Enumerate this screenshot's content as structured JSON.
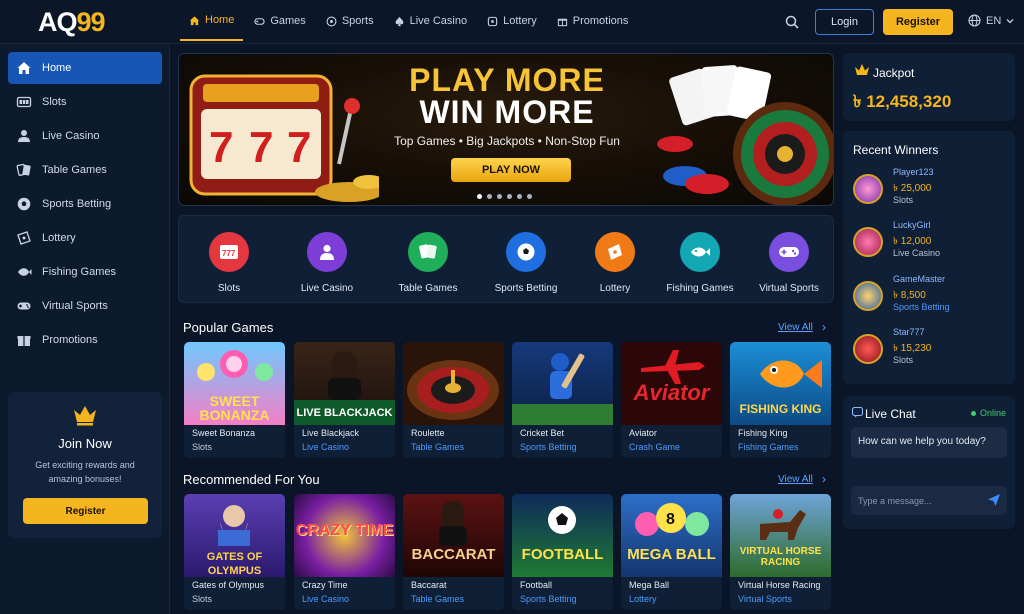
{
  "brand": {
    "prefix": "AQ",
    "suffix": "99"
  },
  "nav": [
    {
      "label": "Home",
      "icon": "home-icon",
      "active": true
    },
    {
      "label": "Games",
      "icon": "gamepad-icon"
    },
    {
      "label": "Sports",
      "icon": "soccer-ball-icon"
    },
    {
      "label": "Live Casino",
      "icon": "spade-icon"
    },
    {
      "label": "Lottery",
      "icon": "lottery-ball-icon"
    },
    {
      "label": "Promotions",
      "icon": "gift-icon"
    }
  ],
  "header": {
    "login": "Login",
    "register": "Register",
    "lang": "EN"
  },
  "sidebar": {
    "items": [
      {
        "label": "Home",
        "icon": "home-icon",
        "active": true
      },
      {
        "label": "Slots",
        "icon": "slot-machine-icon"
      },
      {
        "label": "Live Casino",
        "icon": "dealer-icon"
      },
      {
        "label": "Table Games",
        "icon": "cards-icon"
      },
      {
        "label": "Sports Betting",
        "icon": "soccer-ball-icon"
      },
      {
        "label": "Lottery",
        "icon": "ticket-icon"
      },
      {
        "label": "Fishing Games",
        "icon": "fish-icon"
      },
      {
        "label": "Virtual Sports",
        "icon": "controller-icon"
      },
      {
        "label": "Promotions",
        "icon": "gift-icon"
      }
    ],
    "promo": {
      "title": "Join Now",
      "desc": "Get exciting rewards and amazing bonuses!",
      "button": "Register"
    }
  },
  "banner": {
    "title1": "PLAY MORE",
    "title2": "WIN MORE",
    "subtitle": "Top Games  •  Big Jackpots  •  Non-Stop Fun",
    "button": "PLAY NOW",
    "slides": 6,
    "active_slide": 0
  },
  "categories": [
    {
      "label": "Slots",
      "color": "#e5373f"
    },
    {
      "label": "Live Casino",
      "color": "#7c3ed6"
    },
    {
      "label": "Table Games",
      "color": "#1fae5a"
    },
    {
      "label": "Sports Betting",
      "color": "#1f6fe0"
    },
    {
      "label": "Lottery",
      "color": "#f07a16"
    },
    {
      "label": "Fishing Games",
      "color": "#12a7b3"
    },
    {
      "label": "Virtual Sports",
      "color": "#7a4fe0"
    }
  ],
  "popular": {
    "title": "Popular Games",
    "view_all": "View All",
    "games": [
      {
        "art": "SWEET BONANZA",
        "name": "Sweet Bonanza",
        "category": "Slots",
        "blue": false
      },
      {
        "art": "LIVE BLACKJACK",
        "name": "Live Blackjack",
        "category": "Live Casino",
        "blue": true
      },
      {
        "art": "",
        "name": "Roulette",
        "category": "Table Games",
        "blue": true
      },
      {
        "art": "",
        "name": "Cricket Bet",
        "category": "Sports Betting",
        "blue": true
      },
      {
        "art": "Aviator",
        "name": "Aviator",
        "category": "Crash Game",
        "blue": true
      },
      {
        "art": "FISHING KING",
        "name": "Fishing King",
        "category": "Fishing Games",
        "blue": true
      }
    ]
  },
  "recommended": {
    "title": "Recommended For You",
    "view_all": "View All",
    "games": [
      {
        "art": "GATES OF OLYMPUS",
        "name": "Gates of Olympus",
        "category": "Slots",
        "blue": false
      },
      {
        "art": "CRAZY TIME",
        "name": "Crazy Time",
        "category": "Live Casino",
        "blue": true
      },
      {
        "art": "BACCARAT",
        "name": "Baccarat",
        "category": "Table Games",
        "blue": true
      },
      {
        "art": "FOOTBALL",
        "name": "Football",
        "category": "Sports Betting",
        "blue": true
      },
      {
        "art": "MEGA BALL",
        "name": "Mega Ball",
        "category": "Lottery",
        "blue": true
      },
      {
        "art": "VIRTUAL HORSE RACING",
        "name": "Virtual Horse Racing",
        "category": "Virtual Sports",
        "blue": true
      }
    ]
  },
  "jackpot": {
    "label": "Jackpot",
    "value": "৳ 12,458,320"
  },
  "winners": {
    "title": "Recent Winners",
    "items": [
      {
        "name": "Player123",
        "amount": "৳ 25,000",
        "game": "Slots",
        "blue": false
      },
      {
        "name": "LuckyGirl",
        "amount": "৳ 12,000",
        "game": "Live Casino",
        "blue": false
      },
      {
        "name": "GameMaster",
        "amount": "৳ 8,500",
        "game": "Sports Betting",
        "blue": true
      },
      {
        "name": "Star777",
        "amount": "৳ 15,230",
        "game": "Slots",
        "blue": false
      }
    ]
  },
  "chat": {
    "title": "Live Chat",
    "status": "Online",
    "message": "How can we help you today?",
    "placeholder": "Type a message..."
  }
}
